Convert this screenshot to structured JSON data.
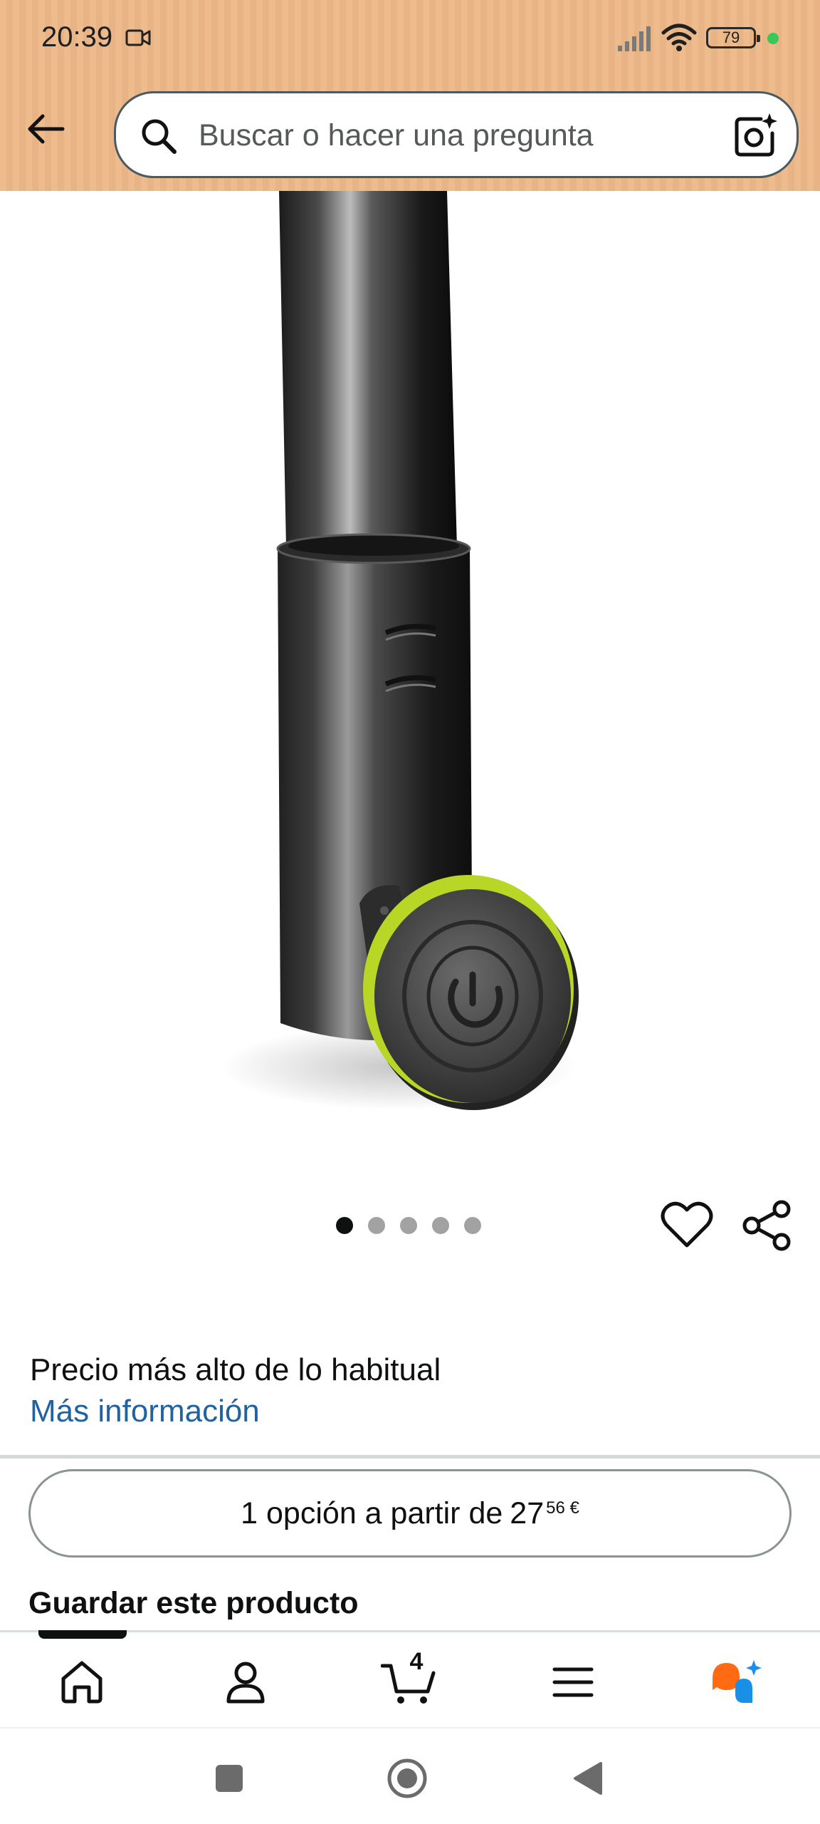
{
  "status_bar": {
    "time": "20:39",
    "battery_level": "79",
    "icons": [
      "video-record-icon",
      "signal-icon",
      "wifi-icon",
      "battery-icon",
      "status-dot"
    ]
  },
  "header": {
    "back_icon": "arrow-left-icon",
    "search": {
      "placeholder": "Buscar o hacer una pregunta",
      "icon": "search-icon",
      "camera_icon": "camera-search-icon"
    }
  },
  "product": {
    "image": "black telescopic speaker stand pole with lime-green ring locking knob",
    "image_count": 5,
    "current_image": 1
  },
  "actions": {
    "wishlist_icon": "heart-icon",
    "share_icon": "share-icon"
  },
  "price_info": {
    "note": "Precio más alto de lo habitual",
    "link": "Más información"
  },
  "options": {
    "label": "1 opción a partir de",
    "price_whole": "27",
    "price_fraction": "56 €"
  },
  "save_section": {
    "heading": "Guardar este producto"
  },
  "bottom_nav": {
    "active": "home",
    "cart_count": "4",
    "items": [
      "home-icon",
      "account-icon",
      "cart-icon",
      "menu-icon",
      "assistant-icon"
    ]
  },
  "colors": {
    "header_bg": "#edbb8c",
    "link": "#2162a1",
    "text": "#0f1111",
    "accent_green": "#b7d626",
    "assistant_orange": "#ff6a13",
    "assistant_blue": "#1a8fe8"
  }
}
